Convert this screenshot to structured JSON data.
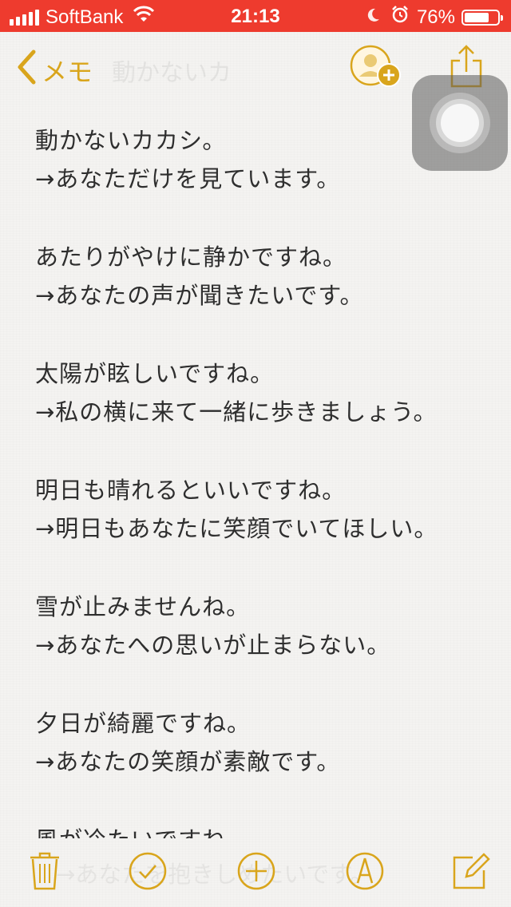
{
  "status_bar": {
    "carrier": "SoftBank",
    "time": "21:13",
    "battery": "76%",
    "battery_level": 0.76
  },
  "nav": {
    "back_label": "メモ",
    "ghost_title": "動かないカ"
  },
  "note": {
    "lines": [
      "動かないカカシ。",
      "→あなただけを見ています。",
      "",
      "あたりがやけに静かですね。",
      "→あなたの声が聞きたいです。",
      "",
      "太陽が眩しいですね。",
      "→私の横に来て一緒に歩きましょう。",
      "",
      "明日も晴れるといいですね。",
      "→明日もあなたに笑顔でいてほしい。",
      "",
      "雪が止みませんね。",
      "→あなたへの思いが止まらない。",
      "",
      "夕日が綺麗ですね。",
      "→あなたの笑顔が素敵です。",
      "",
      "風が冷たいですね。"
    ]
  },
  "toolbar": {
    "ghost_text": "→あなたを抱きしめたいです。"
  },
  "colors": {
    "accent": "#d9a51c",
    "status_bar": "#ee3b2e",
    "text": "#2e2e2e"
  }
}
